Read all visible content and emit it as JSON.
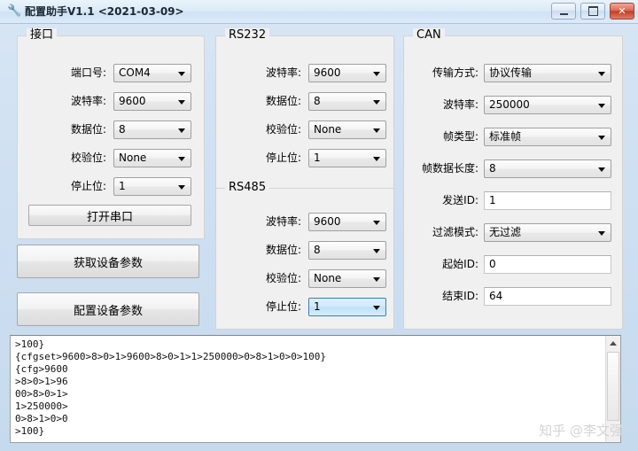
{
  "window": {
    "icon": "wrench-icon",
    "title": "配置助手V1.1  <2021-03-09>",
    "minimize_label": "",
    "maximize_label": "",
    "close_label": "✕"
  },
  "interface_group": {
    "legend": "接口",
    "rows": [
      {
        "label": "端口号:",
        "value": "COM4"
      },
      {
        "label": "波特率:",
        "value": "9600"
      },
      {
        "label": "数据位:",
        "value": "8"
      },
      {
        "label": "校验位:",
        "value": "None"
      },
      {
        "label": "停止位:",
        "value": "1"
      }
    ],
    "open_port_button": "打开串口"
  },
  "actions": {
    "get_params_button": "获取设备参数",
    "set_params_button": "配置设备参数"
  },
  "rs232_group": {
    "legend": "RS232",
    "rows": [
      {
        "label": "波特率:",
        "value": "9600"
      },
      {
        "label": "数据位:",
        "value": "8"
      },
      {
        "label": "校验位:",
        "value": "None"
      },
      {
        "label": "停止位:",
        "value": "1"
      }
    ]
  },
  "rs485_group": {
    "legend": "RS485",
    "rows": [
      {
        "label": "波特率:",
        "value": "9600"
      },
      {
        "label": "数据位:",
        "value": "8"
      },
      {
        "label": "校验位:",
        "value": "None"
      },
      {
        "label": "停止位:",
        "value": "1"
      }
    ]
  },
  "can_group": {
    "legend": "CAN",
    "rows": [
      {
        "label": "传输方式:",
        "value": "协议传输",
        "type": "combo"
      },
      {
        "label": "波特率:",
        "value": "250000",
        "type": "combo"
      },
      {
        "label": "帧类型:",
        "value": "标准帧",
        "type": "combo"
      },
      {
        "label": "帧数据长度:",
        "value": "8",
        "type": "combo"
      },
      {
        "label": "发送ID:",
        "value": "1",
        "type": "text"
      },
      {
        "label": "过滤模式:",
        "value": "无过滤",
        "type": "combo"
      },
      {
        "label": "起始ID:",
        "value": "0",
        "type": "text"
      },
      {
        "label": "结束ID:",
        "value": "64",
        "type": "text"
      }
    ]
  },
  "log": {
    "content": ">100}\n{cfgset>9600>8>0>1>9600>8>0>1>1>250000>0>8>1>0>0>100}\n{cfg>9600\n>8>0>1>96\n00>8>0>1>\n1>250000>\n0>8>1>0>0\n>100}"
  },
  "watermark": {
    "text": "知乎 @李文强"
  },
  "colors": {
    "accent": "#3c7fb1",
    "close_button": "#c33d27",
    "panel": "#f0f0f0"
  }
}
